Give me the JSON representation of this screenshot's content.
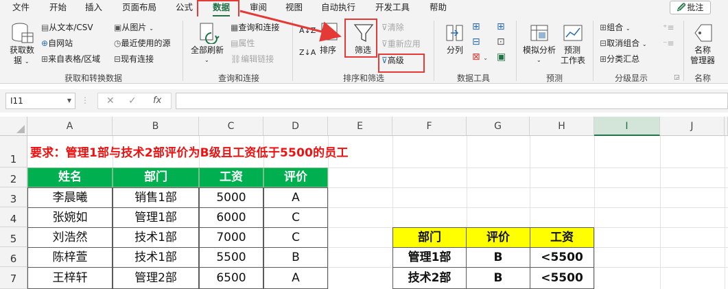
{
  "menu": {
    "items": [
      "文件",
      "开始",
      "插入",
      "页面布局",
      "公式",
      "数据",
      "审阅",
      "视图",
      "自动执行",
      "开发工具",
      "帮助"
    ],
    "active": "数据",
    "share_label": "批注"
  },
  "ribbon": {
    "get_data": {
      "big_label_1": "获取数",
      "big_label_2": "据",
      "from_text": "从文本/CSV",
      "from_web": "自网站",
      "from_table": "来自表格/区域",
      "from_picture": "从图片",
      "recent_sources": "最近使用的源",
      "existing_conn": "现有连接",
      "group_label": "获取和转换数据"
    },
    "queries": {
      "refresh_all": "全部刷新",
      "queries_conn": "查询和连接",
      "properties": "属性",
      "edit_links": "编辑链接",
      "group_label": "查询和连接"
    },
    "sort_filter": {
      "sort": "排序",
      "filter": "筛选",
      "clear": "清除",
      "reapply": "重新应用",
      "advanced": "高级",
      "group_label": "排序和筛选"
    },
    "data_tools": {
      "split": "分列",
      "group_label": "数据工具"
    },
    "forecast": {
      "whatif": "模拟分析",
      "forecast_sheet_1": "预测",
      "forecast_sheet_2": "工作表",
      "group_label": "预测"
    },
    "outline": {
      "group": "组合",
      "ungroup": "取消组合",
      "subtotal": "分类汇总",
      "group_label": "分级显示"
    },
    "names": {
      "name_mgr_1": "名称",
      "name_mgr_2": "管理器",
      "group_label": "名称"
    }
  },
  "formula_bar": {
    "name_box": "I11",
    "cancel_glyph": "✕",
    "enter_glyph": "✓",
    "fx_glyph": "fx",
    "value": ""
  },
  "sheet": {
    "columns": [
      "A",
      "B",
      "C",
      "D",
      "E",
      "F",
      "G",
      "H",
      "I",
      "J"
    ],
    "selected_column": "I",
    "rows": [
      "1",
      "2",
      "3",
      "4",
      "5",
      "6",
      "7"
    ],
    "requirement": "要求：管理1部与技术2部评价为B级且工资低于5500的员工",
    "table_headers": [
      "姓名",
      "部门",
      "工资",
      "评价"
    ],
    "table_rows": [
      [
        "李晨曦",
        "销售1部",
        "5000",
        "A"
      ],
      [
        "张婉如",
        "管理1部",
        "6000",
        "C"
      ],
      [
        "刘浩然",
        "技术1部",
        "7000",
        "C"
      ],
      [
        "陈梓萱",
        "技术1部",
        "5500",
        "B"
      ],
      [
        "王梓轩",
        "管理2部",
        "6500",
        "A"
      ]
    ],
    "criteria_headers": [
      "部门",
      "评价",
      "工资"
    ],
    "criteria_rows": [
      [
        "管理1部",
        "B",
        "<5500"
      ],
      [
        "技术2部",
        "B",
        "<5500"
      ]
    ]
  },
  "colors": {
    "accent": "#217346",
    "header_green": "#00b050",
    "criteria_yellow": "#ffff00",
    "annotation_red": "#e53935",
    "requirement_red": "#ee1111"
  }
}
